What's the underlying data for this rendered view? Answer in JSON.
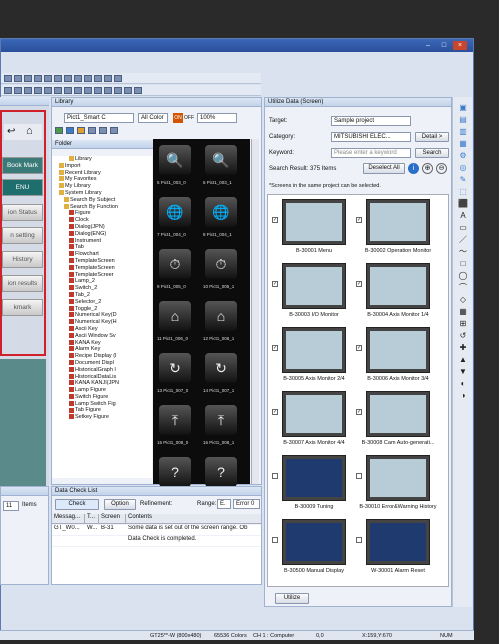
{
  "left_sidebar": {
    "items": [
      "Book Mark",
      "ENU",
      "ion Status",
      "n setting",
      "History",
      "ion results",
      "kmark"
    ]
  },
  "library": {
    "title": "Library",
    "file_field": "Pict1_Smart C",
    "color_select": "All Color",
    "on_label": "ON",
    "off_label": "OFF",
    "zoom": "100%",
    "folder_label": "Folder",
    "tree": [
      "Library",
      "Import",
      "Recent Library",
      "My Favorites",
      "My Library",
      "System Library",
      "Search By Subject",
      "Search By Function",
      "Figure",
      "Clock",
      "Dialog(JPN)",
      "Dialog(ENG)",
      "Instrument",
      "Tab",
      "Flowchart",
      "TemplateScreen",
      "TemplateScreen",
      "TemplateScreer",
      "Lamp_2",
      "Switch_2",
      "Tab_2",
      "Selector_2",
      "Toggle_2",
      "Numerical Key(D",
      "Numerical Key(H",
      "Ascii Key",
      "Ascii Window Sv",
      "KANA Key",
      "Alarm Key",
      "Recipe Display (I",
      "Document Displ",
      "HistoricalGraph I",
      "HistoricalDataLis",
      "KANA KANJI(JPN",
      "Lamp Figure",
      "Switch Figure",
      "Lamp Switch Fig",
      "Tab Figure",
      "Setkey Figure"
    ],
    "thumbs": [
      "5 Pict1_003_0",
      "6 Pict1_003_1",
      "7 Pict1_004_0",
      "8 Pict1_004_1",
      "9 Pict1_005_0",
      "10 Pict1_005_1",
      "11 Pict1_006_0",
      "12 Pict1_006_1",
      "13 Pict1_007_0",
      "14 Pict1_007_1",
      "15 Pict1_008_0",
      "16 Pict1_008_1"
    ]
  },
  "utilize": {
    "title": "Utilize Data (Screen)",
    "target_label": "Target:",
    "target_value": "Sample project",
    "category_label": "Category:",
    "category_value": "MITSUBISHI ELEC...",
    "detail_button": "Detail >",
    "keyword_label": "Keyword:",
    "keyword_placeholder": "Please enter a keyword",
    "search_button": "Search",
    "result_text": "Search Result: 375 Items",
    "deselect_button": "Deselect All",
    "note": "*Screens in the same project can be selected.",
    "screens": [
      "B-30001 Menu",
      "B-30002 Operation Monitor",
      "B-30003 I/O Monitor",
      "B-30004 Axis Monitor 1/4",
      "B-30005 Axis Monitor 2/4",
      "B-30006 Axis Monitor 3/4",
      "B-30007 Axis Monitor 4/4",
      "B-30008 Cam Auto-generati...",
      "B-30009 Tuning",
      "B-30010 Error&Warning History",
      "B-30500 Manual Display",
      "W-30001 Alarm Reset"
    ],
    "utilize_button": "Utilize"
  },
  "bottom_left": {
    "check_button": "11",
    "items_label": "Items"
  },
  "data_check": {
    "title": "Data Check List",
    "check_button": "Check",
    "option_button": "Option",
    "refinement_label": "Refinement:",
    "range_label": "Range:",
    "range_value": "E.",
    "error_label": "Error 0",
    "columns": [
      "Messag...",
      "T...",
      "Screen",
      "Contents"
    ],
    "rows": [
      {
        "msg": "GT_W0...",
        "t": "W...",
        "screen": "B-31",
        "contents": "Some data is set out of the screen range. Ob"
      },
      {
        "msg": "",
        "t": "",
        "screen": "",
        "contents": "Data Check is completed."
      }
    ]
  },
  "statusbar": {
    "model": "GT25**-W (800x480)",
    "colors": "65536 Colors",
    "ch": "CH 1 : Computer",
    "coords0": "0,0",
    "cursor": "X:159,Y:670",
    "num": "NUM"
  },
  "colors": {
    "highlight": "#d0202b",
    "accent": "#2a4f9a"
  }
}
